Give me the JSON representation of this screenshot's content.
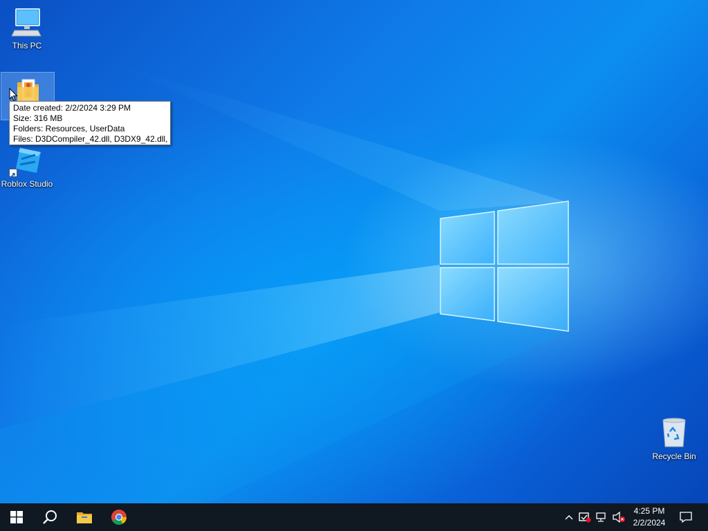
{
  "desktop": {
    "icons": [
      {
        "label": "This PC",
        "icon": "this-pc-icon"
      },
      {
        "label": "",
        "icon": "folder-icon",
        "selected": true
      },
      {
        "label": "Roblox Studio",
        "icon": "roblox-studio-icon",
        "shortcut": true
      },
      {
        "label": "Recycle Bin",
        "icon": "recycle-bin-icon"
      }
    ],
    "tooltip": {
      "line1": "Date created: 2/2/2024 3:29 PM",
      "line2": "Size: 316 MB",
      "line3": "Folders: Resources, UserData",
      "line4": "Files: D3DCompiler_42.dll, D3DX9_42.dll, ..."
    }
  },
  "taskbar": {
    "start": "start-button",
    "search": "search-icon",
    "pinned": [
      "file-explorer-icon",
      "chrome-icon"
    ],
    "tray": {
      "icons": [
        "chevron-up-icon",
        "security-icon",
        "network-icon",
        "volume-muted-icon"
      ],
      "time": "4:25 PM",
      "date": "2/2/2024",
      "notifications": "notification-icon"
    }
  },
  "colors": {
    "taskbar": "#101822",
    "wallpaper_accent": "#0c8ef0",
    "tooltip_border": "#767676"
  }
}
